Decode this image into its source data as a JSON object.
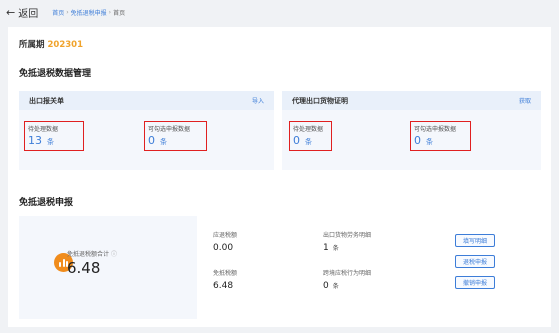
{
  "nav": {
    "back_label": "返回",
    "breadcrumb": [
      "首页",
      "免抵退税申报",
      "首页"
    ]
  },
  "period": {
    "label": "所属期",
    "value": "202301"
  },
  "data_management": {
    "title": "免抵退税数据管理",
    "export_panel": {
      "title": "出口报关单",
      "action": "导入",
      "pending": {
        "label": "待处理数据",
        "value": "13",
        "unit": "条"
      },
      "selectable": {
        "label": "可勾选申报数据",
        "value": "0",
        "unit": "条"
      }
    },
    "agent_panel": {
      "title": "代理出口货物证明",
      "action": "获取",
      "pending": {
        "label": "待处理数据",
        "value": "0",
        "unit": "条"
      },
      "selectable": {
        "label": "可勾选申报数据",
        "value": "0",
        "unit": "条"
      }
    }
  },
  "declaration": {
    "title": "免抵退税申报",
    "total": {
      "label": "免抵退税额合计",
      "info_icon": "ⓘ",
      "value": "6.48"
    },
    "refund": {
      "label": "应退税额",
      "value": "0.00"
    },
    "exempt": {
      "label": "免抵税额",
      "value": "6.48"
    },
    "export_detail": {
      "label": "出口货物劳务明细",
      "value": "1",
      "unit": "条"
    },
    "crossborder_detail": {
      "label": "跨境应税行为明细",
      "value": "0",
      "unit": "条"
    },
    "buttons": {
      "fill": "填写明细",
      "declare": "退税申报",
      "withdraw": "撤销申报"
    }
  },
  "colors": {
    "accent": "#3d7dd8",
    "period": "#f0a32b",
    "highlight_border": "#e02020",
    "coin": "#f08c1c"
  }
}
